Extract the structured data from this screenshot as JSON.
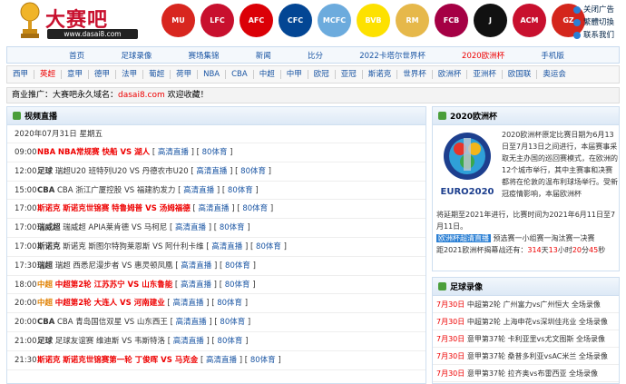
{
  "brand": {
    "name": "大赛吧",
    "url": "www.dasai8.com"
  },
  "clubs": [
    {
      "name": "manutd-badge",
      "color": "#d8261f",
      "abbr": "MU"
    },
    {
      "name": "liverpool-badge",
      "color": "#c8102e",
      "abbr": "LFC"
    },
    {
      "name": "arsenal-badge",
      "color": "#db0007",
      "abbr": "AFC"
    },
    {
      "name": "chelsea-badge",
      "color": "#034694",
      "abbr": "CFC"
    },
    {
      "name": "mancity-badge",
      "color": "#6cabdd",
      "abbr": "MCFC"
    },
    {
      "name": "dortmund-badge",
      "color": "#fde100",
      "abbr": "BVB"
    },
    {
      "name": "realmadrid-badge",
      "color": "#e6b84a",
      "abbr": "RM"
    },
    {
      "name": "barcelona-badge",
      "color": "#a50044",
      "abbr": "FCB"
    },
    {
      "name": "juventus-badge",
      "color": "#111111",
      "abbr": "J"
    },
    {
      "name": "acmilan-badge",
      "color": "#c8102e",
      "abbr": "ACM"
    },
    {
      "name": "guangzhou-badge",
      "color": "#d4261c",
      "abbr": "GZ"
    }
  ],
  "quick": [
    "关闭广告",
    "繁體切換",
    "联系我们"
  ],
  "nav1": [
    "首页",
    "足球录像",
    "赛场集锦",
    "新闻",
    "比分",
    "2022卡塔尔世界杯",
    "2020欧洲杯",
    "手机版"
  ],
  "nav1_active": "2020欧洲杯",
  "nav2": [
    "西甲",
    "英超",
    "意甲",
    "德甲",
    "法甲",
    "葡超",
    "荷甲",
    "NBA",
    "CBA",
    "中超",
    "中甲",
    "欧冠",
    "亚冠",
    "斯诺克",
    "世界杯",
    "欧洲杯",
    "亚洲杯",
    "欧国联",
    "奥运会"
  ],
  "nav2_active": "英超",
  "promo": {
    "prefix": "商业推广：大赛吧永久域名：",
    "url": "dasai8.com",
    "suffix": " 欢迎收藏！"
  },
  "live": {
    "title": "视频直播",
    "date": "2020年07月31日 星期五",
    "matches": [
      {
        "time": "09:00",
        "league": "NBA",
        "style": "red",
        "desc": "NBA常规赛 快船 VS 湖人",
        "links": [
          "高清直播",
          "80体育"
        ]
      },
      {
        "time": "12:00",
        "league": "足球",
        "style": "plain",
        "desc": "瑞超U20 班特列U20 VS 丹德农市U20",
        "links": [
          "高清直播",
          "80体育"
        ]
      },
      {
        "time": "15:00",
        "league": "CBA",
        "style": "plain",
        "desc": "CBA 浙江广厦控股 VS 福建豹发力",
        "links": [
          "高清直播",
          "80体育"
        ]
      },
      {
        "time": "17:00",
        "league": "斯诺克",
        "style": "red",
        "desc": "斯诺克世锦赛 特鲁姆普 VS 汤姆福德",
        "links": [
          "高清直播",
          "80体育"
        ]
      },
      {
        "time": "17:00",
        "league": "瑞威超",
        "style": "plain",
        "desc": "瑞威超 APIA莱肯德 VS 马柯尼",
        "links": [
          "高清直播",
          "80体育"
        ]
      },
      {
        "time": "17:00",
        "league": "斯诺克",
        "style": "plain",
        "desc": "斯诺克 斯图尔特狗莱恩斯 VS 阿什利卡维",
        "links": [
          "高清直播",
          "80体育"
        ]
      },
      {
        "time": "17:30",
        "league": "瑞超",
        "style": "plain",
        "desc": "瑞超 西悉尼漫步者 VS 惠灵顿凤凰",
        "links": [
          "高清直播",
          "80体育"
        ]
      },
      {
        "time": "18:00",
        "league": "中超",
        "style": "orange",
        "desc": "中超第2轮 江苏苏宁 VS 山东鲁能",
        "links": [
          "高清直播",
          "80体育"
        ]
      },
      {
        "time": "20:00",
        "league": "中超",
        "style": "orange",
        "desc": "中超第2轮 大连人 VS 河南建业",
        "links": [
          "高清直播",
          "80体育"
        ]
      },
      {
        "time": "20:00",
        "league": "CBA",
        "style": "plain",
        "desc": "CBA 青岛国信双星 VS 山东西王",
        "links": [
          "高清直播",
          "80体育"
        ]
      },
      {
        "time": "21:00",
        "league": "足球",
        "style": "plain",
        "desc": "足球友谊赛 维迪斯 VS 韦斯特洛",
        "links": [
          "高清直播",
          "80体育"
        ]
      },
      {
        "time": "21:30",
        "league": "斯诺克",
        "style": "red",
        "desc": "斯诺克世锦赛第一轮 丁俊晖 VS 马克金",
        "links": [
          "高清直播",
          "80体育"
        ]
      }
    ]
  },
  "euro": {
    "title": "2020欧洲杯",
    "logo_text": "EURO2020",
    "text": "2020欧洲杯原定比赛日期为6月13日至7月13日之间进行，本届赛事采取无主办国的巡回赛模式，在欧洲的12个城市举行，其中主赛事和决赛都将在伦敦的温布利球场举行。受新冠疫情影响，本届欧洲杯将延期至2021年进行，比赛时间为2021年6月11日至7月11日。",
    "tag": "欧洲杯超清直播",
    "after_tag": " 预选赛一小组赛一淘汰赛一决赛",
    "countdown_prefix": "距2021欧洲杯揭幕战还有：",
    "days": "314",
    "hours": "13",
    "mins": "20",
    "secs": "45"
  },
  "replays": {
    "title": "足球录像",
    "items": [
      {
        "date": "7月30日",
        "text": "中超第2轮 广州富力vs广州恒大 全场录像"
      },
      {
        "date": "7月30日",
        "text": "中超第2轮 上海申花vs深圳佳兆业 全场录像"
      },
      {
        "date": "7月30日",
        "text": "意甲第37轮 卡利亚里vs尤文图斯 全场录像"
      },
      {
        "date": "7月30日",
        "text": "意甲第37轮 桑普多利亚vsAC米兰 全场录像"
      },
      {
        "date": "7月30日",
        "text": "意甲第37轮 拉齐奥vs布雷西亚 全场录像"
      }
    ]
  }
}
